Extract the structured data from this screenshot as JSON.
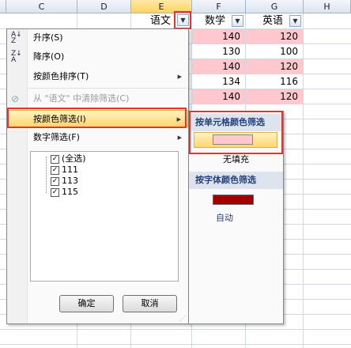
{
  "columns": [
    "C",
    "D",
    "E",
    "F",
    "G",
    "H"
  ],
  "header_row": {
    "e": "语文",
    "f": "数学",
    "g": "英语"
  },
  "rows": [
    {
      "f": "140",
      "g": "120",
      "highlight": true
    },
    {
      "f": "130",
      "g": "100",
      "highlight": false
    },
    {
      "f": "140",
      "g": "120",
      "highlight": true
    },
    {
      "f": "134",
      "g": "116",
      "highlight": false
    },
    {
      "f": "140",
      "g": "120",
      "highlight": true
    }
  ],
  "menu": {
    "sort_asc": "升序(S)",
    "sort_desc": "降序(O)",
    "sort_by_color": "按颜色排序(T)",
    "clear_filter": "从 \"语文\" 中清除筛选(C)",
    "filter_by_color": "按颜色筛选(I)",
    "number_filter": "数字筛选(F)",
    "tree": [
      "(全选)",
      "111",
      "113",
      "115"
    ],
    "ok": "确定",
    "cancel": "取消"
  },
  "submenu": {
    "cell_color_title": "按单元格颜色筛选",
    "no_fill": "无填充",
    "font_color_title": "按字体颜色筛选",
    "auto": "自动",
    "cell_color_swatch": "#ffc7ce",
    "font_color_swatch": "#a50000"
  },
  "colors": {
    "highlight": "#ffc7ce",
    "accent_frame": "#e8322c"
  }
}
